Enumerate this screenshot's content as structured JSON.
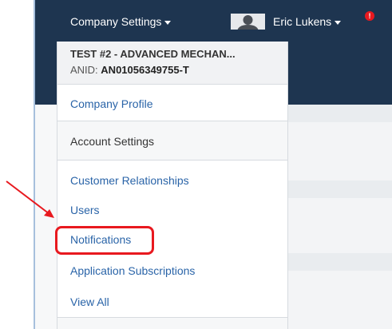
{
  "header": {
    "company_menu_label": "Company Settings",
    "user_menu_label": "Eric Lukens",
    "alert_badge": "!"
  },
  "dropdown": {
    "company_name": "TEST #2 - ADVANCED MECHAN...",
    "anid_label": "ANID:",
    "anid_value": "AN01056349755-T",
    "items": [
      {
        "label": "Company Profile",
        "kind": "link"
      },
      {
        "label": "Account Settings",
        "kind": "section"
      },
      {
        "label": "Customer Relationships",
        "kind": "link"
      },
      {
        "label": "Users",
        "kind": "link"
      },
      {
        "label": "Notifications",
        "kind": "link"
      },
      {
        "label": "Application Subscriptions",
        "kind": "link"
      },
      {
        "label": "View All",
        "kind": "link"
      }
    ]
  },
  "annotation": {
    "color": "#e8191f",
    "target": "Notifications"
  },
  "colors": {
    "header_bg": "#1e3550",
    "link": "#2a64a8",
    "text": "#333333"
  }
}
